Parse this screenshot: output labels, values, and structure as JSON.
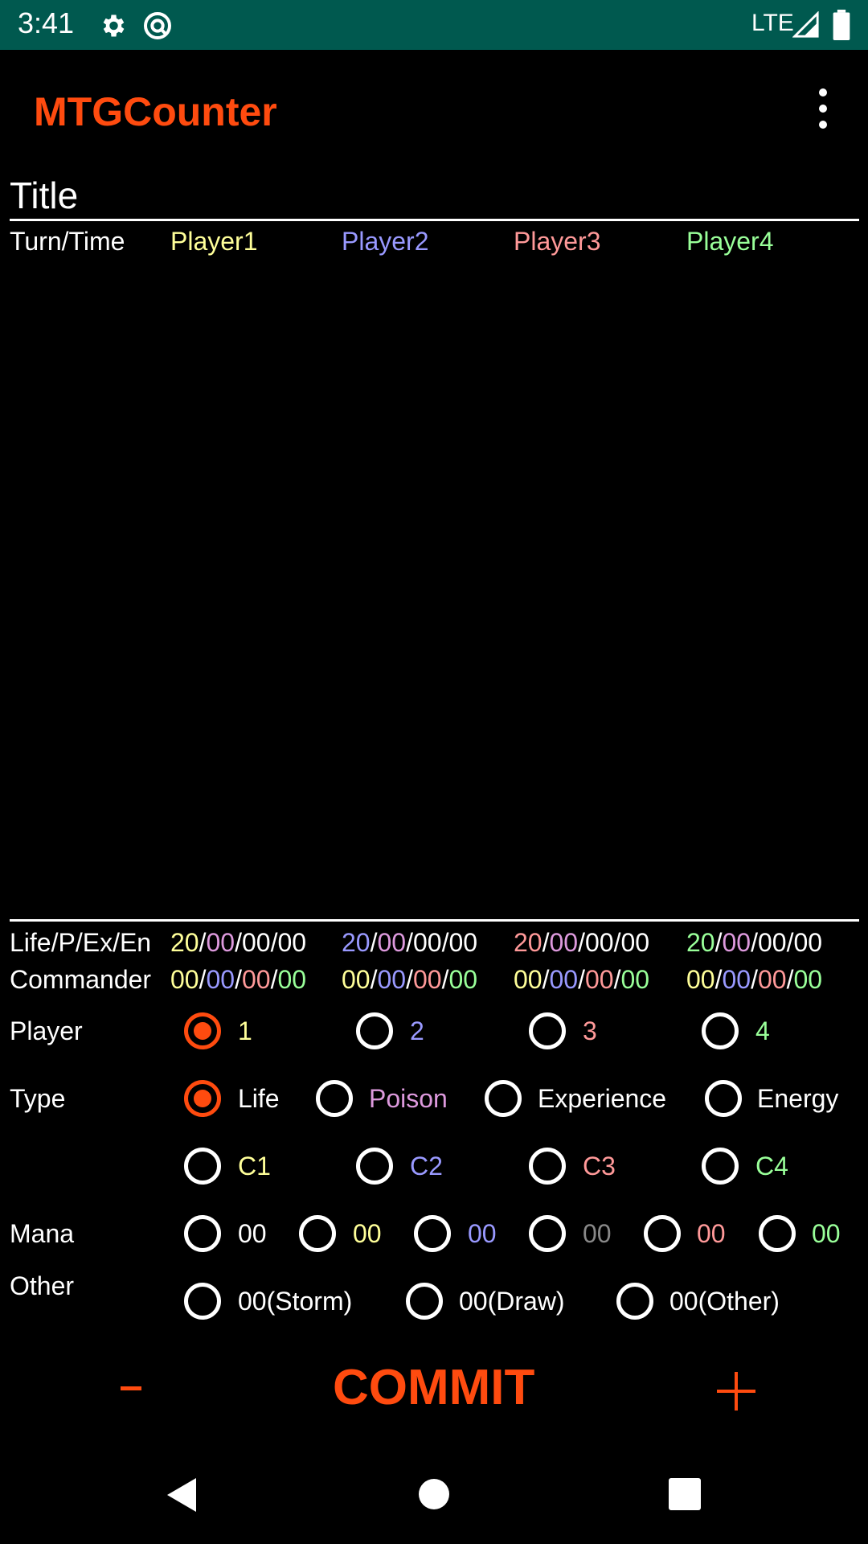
{
  "status_bar": {
    "time": "3:41",
    "network": "LTE"
  },
  "app": {
    "title": "MTGCounter",
    "menu_icon": "more-vert-icon"
  },
  "game": {
    "title": "Title"
  },
  "log_header": {
    "turn_time": "Turn/Time",
    "players": [
      "Player1",
      "Player2",
      "Player3",
      "Player4"
    ]
  },
  "colors": {
    "accent": "#ff4b0f",
    "statusbar": "#00594f",
    "p1": "#ffff99",
    "p2": "#9999ff",
    "p3": "#ff9999",
    "p4": "#99ff99",
    "poison": "#dd99dd",
    "grey": "#888888"
  },
  "stats": {
    "life_label": "Life/P/Ex/En",
    "commander_label": "Commander",
    "life": [
      {
        "life": "20",
        "poison": "00",
        "exp": "00",
        "energy": "00"
      },
      {
        "life": "20",
        "poison": "00",
        "exp": "00",
        "energy": "00"
      },
      {
        "life": "20",
        "poison": "00",
        "exp": "00",
        "energy": "00"
      },
      {
        "life": "20",
        "poison": "00",
        "exp": "00",
        "energy": "00"
      }
    ],
    "commander": [
      [
        "00",
        "00",
        "00",
        "00"
      ],
      [
        "00",
        "00",
        "00",
        "00"
      ],
      [
        "00",
        "00",
        "00",
        "00"
      ],
      [
        "00",
        "00",
        "00",
        "00"
      ]
    ],
    "sep": "/"
  },
  "controls": {
    "player_label": "Player",
    "players": [
      "1",
      "2",
      "3",
      "4"
    ],
    "selected_player": "1",
    "type_label": "Type",
    "types": [
      "Life",
      "Poison",
      "Experience",
      "Energy"
    ],
    "selected_type": "Life",
    "commanders": [
      "C1",
      "C2",
      "C3",
      "C4"
    ],
    "mana_label": "Mana",
    "mana": [
      "00",
      "00",
      "00",
      "00",
      "00",
      "00"
    ],
    "other_label": "Other",
    "other": [
      "00(Storm)",
      "00(Draw)",
      "00(Other)"
    ]
  },
  "actions": {
    "minus": "-",
    "commit": "COMMIT",
    "plus": "+"
  }
}
